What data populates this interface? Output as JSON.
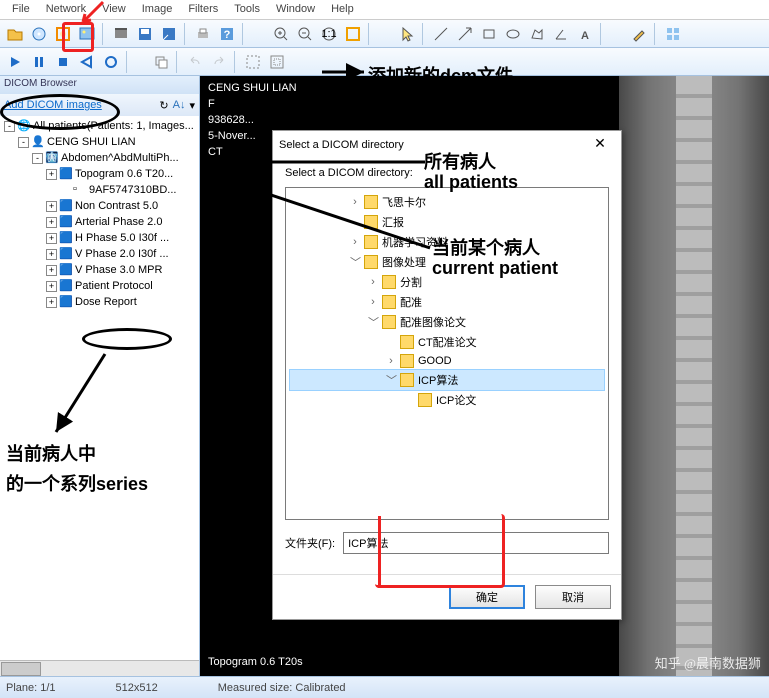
{
  "menu": {
    "items": [
      "File",
      "Network",
      "View",
      "Image",
      "Filters",
      "Tools",
      "Window",
      "Help"
    ]
  },
  "sidebar": {
    "header": "DICOM Browser",
    "add": "Add DICOM images",
    "tree": [
      {
        "l": 0,
        "t": "-",
        "i": "globe",
        "label": "All patients(Patients: 1, Images..."
      },
      {
        "l": 1,
        "t": "-",
        "i": "person",
        "label": "CENG SHUI LIAN"
      },
      {
        "l": 2,
        "t": "-",
        "i": "study",
        "label": "Abdomen^AbdMultiPh..."
      },
      {
        "l": 3,
        "t": "+",
        "i": "series",
        "label": "Topogram  0.6  T20..."
      },
      {
        "l": 4,
        "t": "",
        "i": "img",
        "label": "9AF5747310BD..."
      },
      {
        "l": 3,
        "t": "+",
        "i": "series",
        "label": "Non Contrast  5.0"
      },
      {
        "l": 3,
        "t": "+",
        "i": "series",
        "label": "Arterial Phase  2.0"
      },
      {
        "l": 3,
        "t": "+",
        "i": "series",
        "label": "H Phase  5.0  I30f ..."
      },
      {
        "l": 3,
        "t": "+",
        "i": "series",
        "label": "V Phase  2.0  I30f ..."
      },
      {
        "l": 3,
        "t": "+",
        "i": "series",
        "label": "V Phase  3.0  MPR"
      },
      {
        "l": 3,
        "t": "+",
        "i": "series",
        "label": "Patient Protocol"
      },
      {
        "l": 3,
        "t": "+",
        "i": "series",
        "label": "Dose Report"
      }
    ]
  },
  "viewer": {
    "name": "CENG SHUI LIAN",
    "sex": "F",
    "id": "938628...",
    "date": "5-Nover...",
    "mod": "CT",
    "bottom": "Topogram  0.6  T20s"
  },
  "dialog": {
    "title": "Select a DICOM directory",
    "prompt": "Select a DICOM directory:",
    "tree": [
      {
        "l": 0,
        "c": ">",
        "label": "飞思卡尔"
      },
      {
        "l": 0,
        "c": "",
        "label": "汇报"
      },
      {
        "l": 0,
        "c": ">",
        "label": "机器学习资料"
      },
      {
        "l": 0,
        "c": "v",
        "label": "图像处理"
      },
      {
        "l": 1,
        "c": ">",
        "label": "分割"
      },
      {
        "l": 1,
        "c": ">",
        "label": "配准"
      },
      {
        "l": 1,
        "c": "v",
        "label": "配准图像论文"
      },
      {
        "l": 2,
        "c": "",
        "label": "CT配准论文"
      },
      {
        "l": 2,
        "c": ">",
        "label": "GOOD"
      },
      {
        "l": 2,
        "c": "v",
        "label": "ICP算法",
        "sel": true
      },
      {
        "l": 3,
        "c": "",
        "label": "ICP论文"
      }
    ],
    "folder_label": "文件夹(F):",
    "folder_value": "ICP算法",
    "ok": "确定",
    "cancel": "取消"
  },
  "status": {
    "plane": "Plane: 1/1",
    "dim": "512x512",
    "meas": "Measured size: Calibrated"
  },
  "ann": {
    "a1": "添加新的dcm文件",
    "a2a": "所有病人",
    "a2b": "all patients",
    "a3a": "当前某个病人",
    "a3b": "current patient",
    "a4a": "当前病人中",
    "a4b": "的一个系列series"
  },
  "watermark": "知乎 @晨南数据狮"
}
